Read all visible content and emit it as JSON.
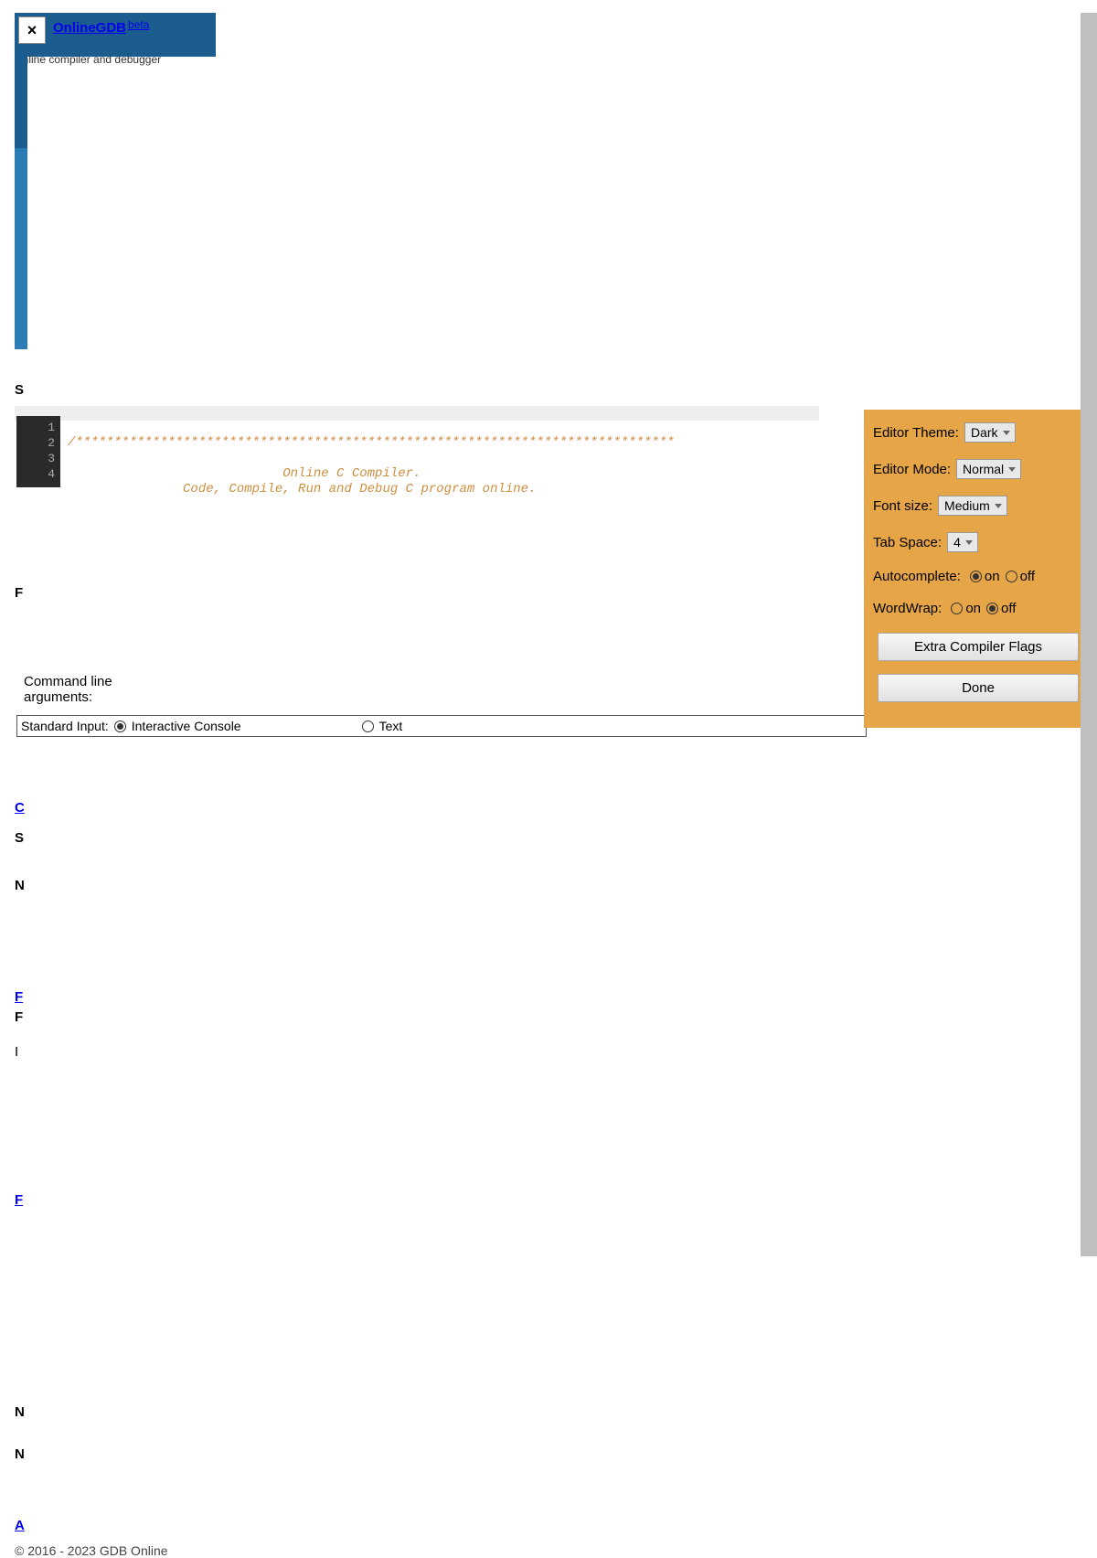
{
  "header": {
    "close_glyph": "×",
    "title": "OnlineGDB",
    "beta": "beta",
    "subtitle": "online compiler and debugger"
  },
  "editor": {
    "line_numbers": [
      "1",
      "2",
      "3",
      "4"
    ],
    "code_lines": [
      "/******************************************************************************",
      "                            Online C Compiler.",
      "               Code, Compile, Run and Debug C program online."
    ],
    "fold_marker": "▾"
  },
  "cli": {
    "label": "Command line\narguments:",
    "stdin_label": "Standard Input:",
    "opt_interactive": "Interactive Console",
    "opt_text": "Text"
  },
  "settings": {
    "theme_label": "Editor Theme:",
    "theme_value": "Dark",
    "mode_label": "Editor Mode:",
    "mode_value": "Normal",
    "fontsize_label": "Font size:",
    "fontsize_value": "Medium",
    "tabspace_label": "Tab Space:",
    "tabspace_value": "4",
    "autocomplete_label": "Autocomplete:",
    "wordwrap_label": "WordWrap:",
    "on": "on",
    "off": "off",
    "extra_flags": "Extra Compiler Flags",
    "done": "Done"
  },
  "clipped": {
    "s1": "S",
    "f1": "F",
    "c1": "C",
    "s2": "S",
    "n1": "N",
    "f2": "F",
    "f3": "F",
    "i1": "I",
    "f4": "F",
    "n2": "N",
    "n3": "N",
    "a1": "A"
  },
  "footer": "© 2016 - 2023 GDB Online"
}
